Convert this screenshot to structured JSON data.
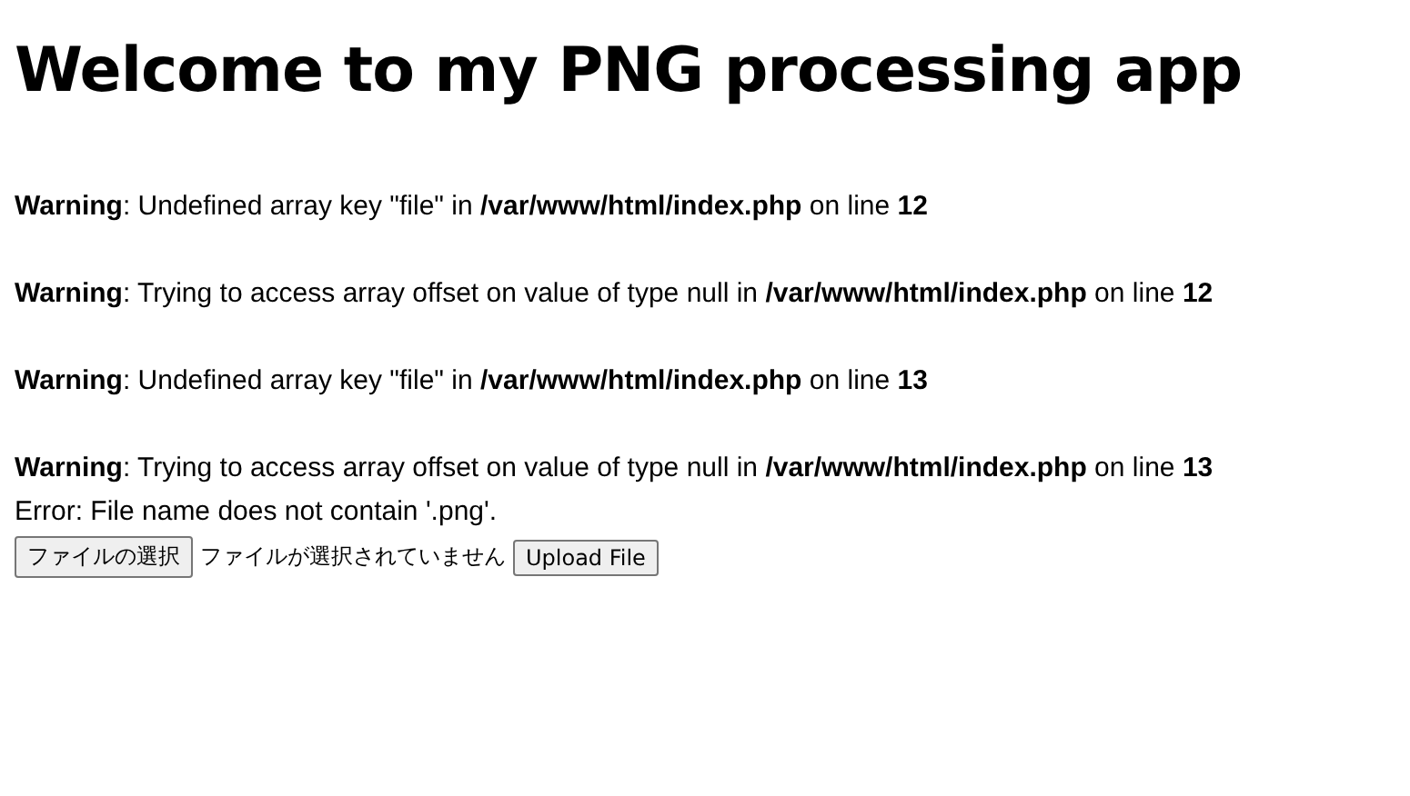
{
  "heading": "Welcome to my PNG processing app",
  "warnings": [
    "**Warning**: Undefined array key \"file\" in **/var/www/html/index.php** on line **12**",
    "**Warning**: Trying to access array offset on value of type null in **/var/www/html/index.php** on line **12**",
    "**Warning**: Undefined array key \"file\" in **/var/www/html/index.php** on line **13**",
    "**Warning**: Trying to access array offset on value of type null in **/var/www/html/index.php** on line **13**"
  ],
  "error": "Error: File name does not contain '.png'.",
  "form": {
    "choose_button": "ファイルの選択",
    "file_status": "ファイルが選択されていません",
    "upload_button": "Upload File"
  }
}
